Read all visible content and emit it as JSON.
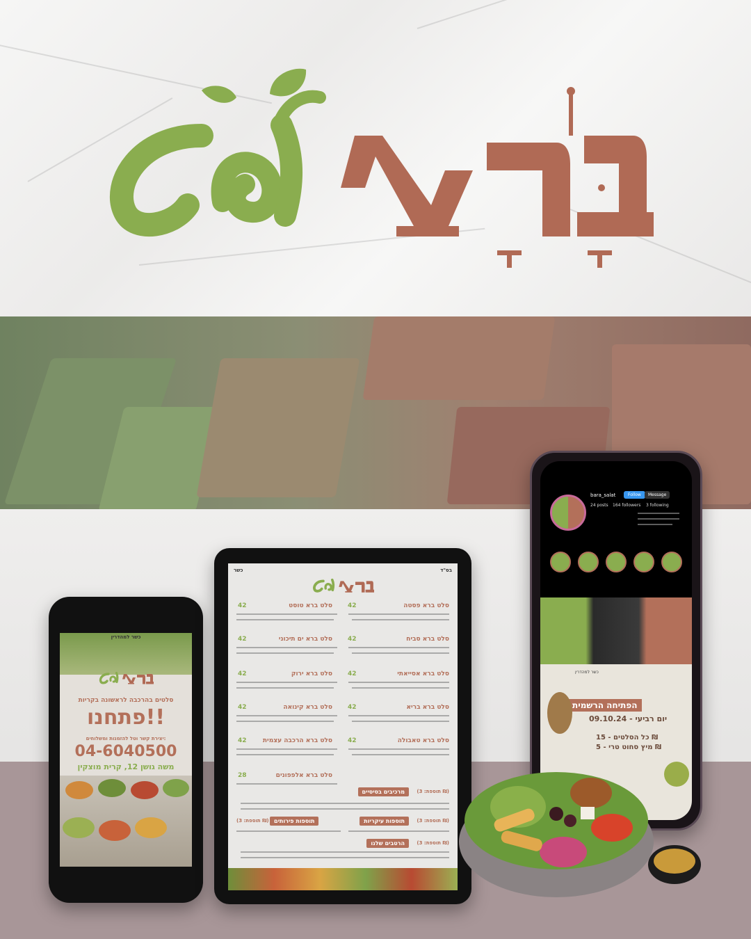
{
  "brand": {
    "name_hebrew": "בָּרָא סלט",
    "colors": {
      "green": "#8aad4f",
      "brown": "#b3705a",
      "marble": "#f3f2f1",
      "floor": "#a89698"
    }
  },
  "small_phone": {
    "kosher_label": "כשר למהדרין",
    "tagline": "סלטים בהרכבה לראשונה בקריות",
    "headline": "פתחנו!!",
    "contact_label": "יצירת קשר וטל להזמנות ומשלוחים:",
    "phone": "04-6040500",
    "address": "משה גושן 12, קרית מוצקין"
  },
  "tablet_menu": {
    "top_left": "כשר",
    "top_right": "בס\"ד",
    "items_right": [
      {
        "name": "סלט ברא פסטה",
        "price": "42"
      },
      {
        "name": "סלט ברא סביח",
        "price": "42"
      },
      {
        "name": "סלט ברא אסייאתי",
        "price": "42"
      },
      {
        "name": "סלט ברא בריא",
        "price": "42"
      },
      {
        "name": "סלט ברא טאבולה",
        "price": "42"
      }
    ],
    "items_left": [
      {
        "name": "סלט ברא טוסט",
        "price": "42"
      },
      {
        "name": "סלט ברא ים תיכוני",
        "price": "42"
      },
      {
        "name": "סלט ברא ירוק",
        "price": "42"
      },
      {
        "name": "סלט ברא קינואה",
        "price": "42"
      },
      {
        "name": "סלט ברא הרכבה עצמית",
        "price": "42"
      },
      {
        "name": "סלט ברא אלפפונים",
        "price": "28"
      }
    ],
    "sections": {
      "base_components": "מרכיבים בסיסיים",
      "base_addon": "(תוספת: 3 ₪)",
      "fruit_addons": "תוספות פירותים",
      "fruit_price": "(תוספת: 3 ₪)",
      "main_addons": "תוספות עיקריות",
      "main_price": "(תוספת: 3 ₪)",
      "dressings": "הרטבים שלנו",
      "dressing_price": "(תוספת: 3 ₪)"
    }
  },
  "big_phone": {
    "username": "bara_salat",
    "follow": "Follow",
    "message": "Message",
    "posts": "24 posts",
    "followers": "164 followers",
    "following": "3 following",
    "post_title": "הפתיחה הרשמית",
    "post_date": "יום רביעי - 09.10.24",
    "post_line1": "כל הסלטים - 15 ₪",
    "post_line2": "מיץ סחוט טרי - 5 ₪",
    "post_kosher": "כשר למהדרין"
  }
}
